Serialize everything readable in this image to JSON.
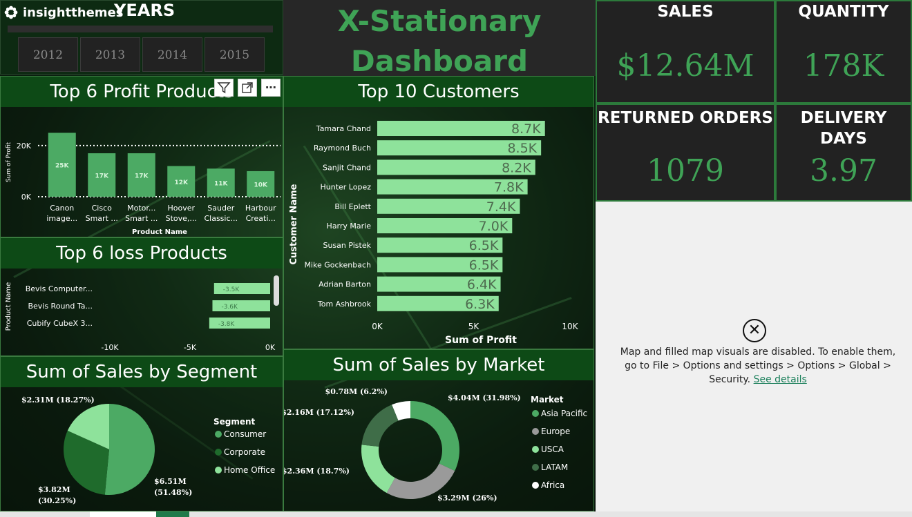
{
  "brand": {
    "name": "insightthemes"
  },
  "years": {
    "title": "YEARS",
    "options": [
      "2012",
      "2013",
      "2014",
      "2015"
    ]
  },
  "dashboard": {
    "title_line1": "X-Stationary",
    "title_line2": "Dashboard"
  },
  "kpis": [
    {
      "label": "SALES",
      "value": "$12.64M"
    },
    {
      "label": "QUANTITY",
      "value": "178K"
    },
    {
      "label": "RETURNED ORDERS",
      "value": "1079"
    },
    {
      "label": "DELIVERY DAYS",
      "value": "3.97"
    }
  ],
  "visual_header": {
    "filter_icon": "filter-icon",
    "focus_icon": "focus-mode-icon",
    "more_icon": "more-options-icon"
  },
  "map_notice": {
    "text": "Map and filled map visuals are disabled. To enable them, go to File > Options and settings > Options > Global > Security.",
    "link": "See details"
  },
  "colors": {
    "accent": "#3fa356",
    "bar_light": "#8ee29b",
    "bar_mid": "#4caa64",
    "panel_header": "#0d4a16"
  },
  "chart_data": [
    {
      "id": "top-profit",
      "type": "bar",
      "title": "Top 6 Profit Products",
      "xlabel": "Product Name",
      "ylabel": "Sum of Profit",
      "categories": [
        "Canon image...",
        "Cisco Smart ...",
        "Motor... Smart ...",
        "Hoover Stove,...",
        "Sauder Classic...",
        "Harbour Creati..."
      ],
      "category_lines": [
        [
          "Canon",
          "image..."
        ],
        [
          "Cisco",
          "Smart ..."
        ],
        [
          "Motor...",
          "Smart ..."
        ],
        [
          "Hoover",
          "Stove,..."
        ],
        [
          "Sauder",
          "Classic..."
        ],
        [
          "Harbour",
          "Creati..."
        ]
      ],
      "values": [
        25000,
        17000,
        17000,
        12000,
        11000,
        10000
      ],
      "data_labels": [
        "25K",
        "17K",
        "17K",
        "12K",
        "11K",
        "10K"
      ],
      "yticks": [
        "0K",
        "20K"
      ],
      "ylim": [
        0,
        27000
      ]
    },
    {
      "id": "top-loss",
      "type": "bar",
      "orientation": "horizontal",
      "title": "Top 6 loss Products",
      "ylabel": "Product Name",
      "categories": [
        "Bevis Computer...",
        "Bevis Round Ta...",
        "Cubify CubeX 3..."
      ],
      "values": [
        -3500,
        -3600,
        -3800
      ],
      "data_labels": [
        "-3.5K",
        "-3.6K",
        "-3.8K"
      ],
      "xticks": [
        "-10K",
        "-5K",
        "0K"
      ],
      "xlim": [
        -10000,
        0
      ]
    },
    {
      "id": "top-customers",
      "type": "bar",
      "orientation": "horizontal",
      "title": "Top 10 Customers",
      "xlabel": "Sum of Profit",
      "ylabel": "Customer Name",
      "categories": [
        "Tamara Chand",
        "Raymond Buch",
        "Sanjit Chand",
        "Hunter Lopez",
        "Bill Eplett",
        "Harry Marie",
        "Susan Pistek",
        "Mike Gockenbach",
        "Adrian Barton",
        "Tom Ashbrook"
      ],
      "values": [
        8700,
        8500,
        8200,
        7800,
        7400,
        7000,
        6500,
        6500,
        6400,
        6300
      ],
      "data_labels": [
        "8.7K",
        "8.5K",
        "8.2K",
        "7.8K",
        "7.4K",
        "7.0K",
        "6.5K",
        "6.5K",
        "6.4K",
        "6.3K"
      ],
      "xticks": [
        "0K",
        "5K",
        "10K"
      ],
      "xlim": [
        0,
        10000
      ]
    },
    {
      "id": "sales-segment",
      "type": "pie",
      "title": "Sum of Sales by Segment",
      "legend_title": "Segment",
      "legend_position": "right",
      "series": [
        {
          "name": "Consumer",
          "value": 6.51,
          "label": "$6.51M (51.48%)",
          "color": "#4caa64"
        },
        {
          "name": "Corporate",
          "value": 3.82,
          "label": "$3.82M (30.25%)",
          "color": "#1f6b2c"
        },
        {
          "name": "Home Office",
          "value": 2.31,
          "label": "$2.31M (18.27%)",
          "color": "#8ee29b"
        }
      ]
    },
    {
      "id": "sales-market",
      "type": "pie",
      "subtype": "donut",
      "title": "Sum of Sales by Market",
      "legend_title": "Market",
      "legend_position": "right",
      "series": [
        {
          "name": "Asia Pacific",
          "value": 4.04,
          "label": "$4.04M (31.98%)",
          "color": "#4caa64"
        },
        {
          "name": "Europe",
          "value": 3.29,
          "label": "$3.29M (26%)",
          "color": "#9a9a9a"
        },
        {
          "name": "USCA",
          "value": 2.36,
          "label": "$2.36M (18.7%)",
          "color": "#8ee29b"
        },
        {
          "name": "LATAM",
          "value": 2.16,
          "label": "$2.16M (17.12%)",
          "color": "#3f6d48"
        },
        {
          "name": "Africa",
          "value": 0.78,
          "label": "$0.78M (6.2%)",
          "color": "#ffffff"
        }
      ]
    }
  ]
}
